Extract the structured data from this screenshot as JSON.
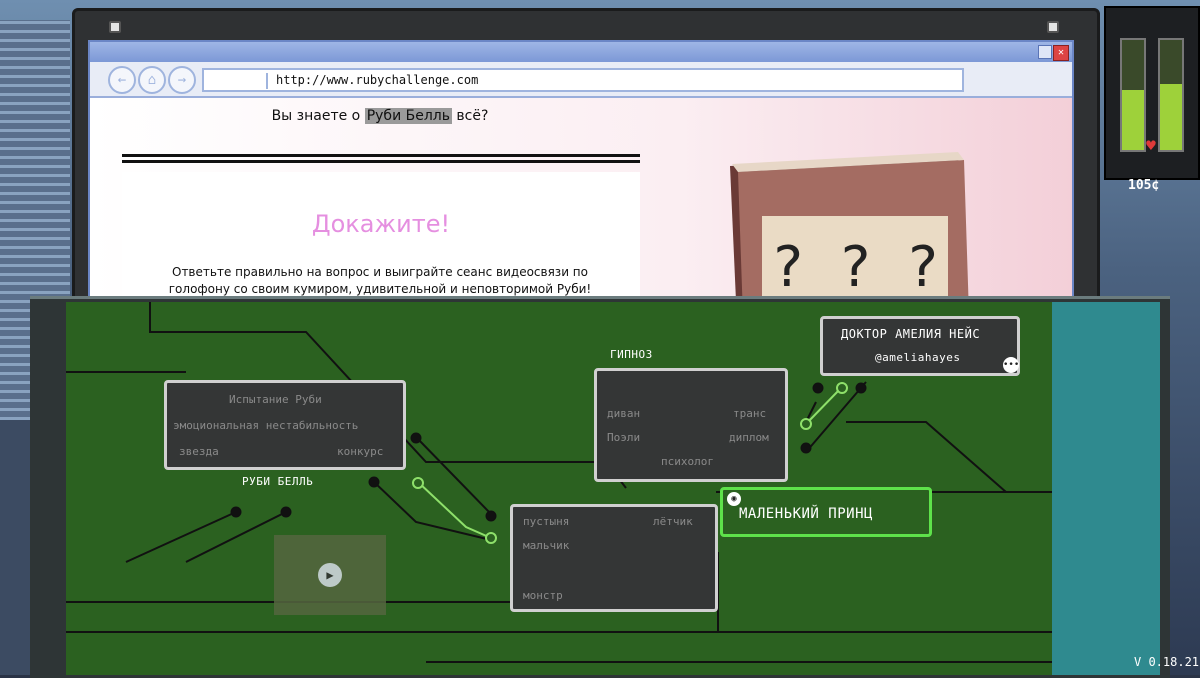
{
  "browser": {
    "url": "http://www.rubychallenge.com",
    "nav_back": "←",
    "nav_home": "⌂",
    "nav_forward": "→"
  },
  "page": {
    "question_prefix": "Вы знаете о ",
    "question_highlight": "Руби Белль",
    "question_suffix": " всё?",
    "headline": "Докажите!",
    "description": "Ответьте правильно на вопрос и выиграйте сеанс видеосвязи по голофону со своим кумиром, удивительной и неповторимой Руби!",
    "book_marks": "? ? ?"
  },
  "hud": {
    "credits": "105¢",
    "version": "V 0.18.21",
    "gauge_left_level": 0.55,
    "gauge_right_level": 0.6,
    "accent_green": "#9ed13a"
  },
  "board": {
    "contact": {
      "name": "ДОКТОР АМЕЛИЯ НЕЙС",
      "handle": "@ameliahayes"
    },
    "ruby": {
      "title": "РУБИ БЕЛЛЬ",
      "items": [
        "Испытание Руби",
        "эмоциональная нестабильность",
        "звезда",
        "конкурс"
      ]
    },
    "hypnosis": {
      "title": "ГИПНОЗ",
      "items": [
        "диван",
        "транс",
        "Поэли",
        "диплом",
        "психолог"
      ]
    },
    "prince_node": {
      "items": [
        "пустыня",
        "лётчик",
        "мальчик",
        "монстр"
      ]
    },
    "answer": {
      "title": "МАЛЕНЬКИЙ ПРИНЦ"
    }
  }
}
